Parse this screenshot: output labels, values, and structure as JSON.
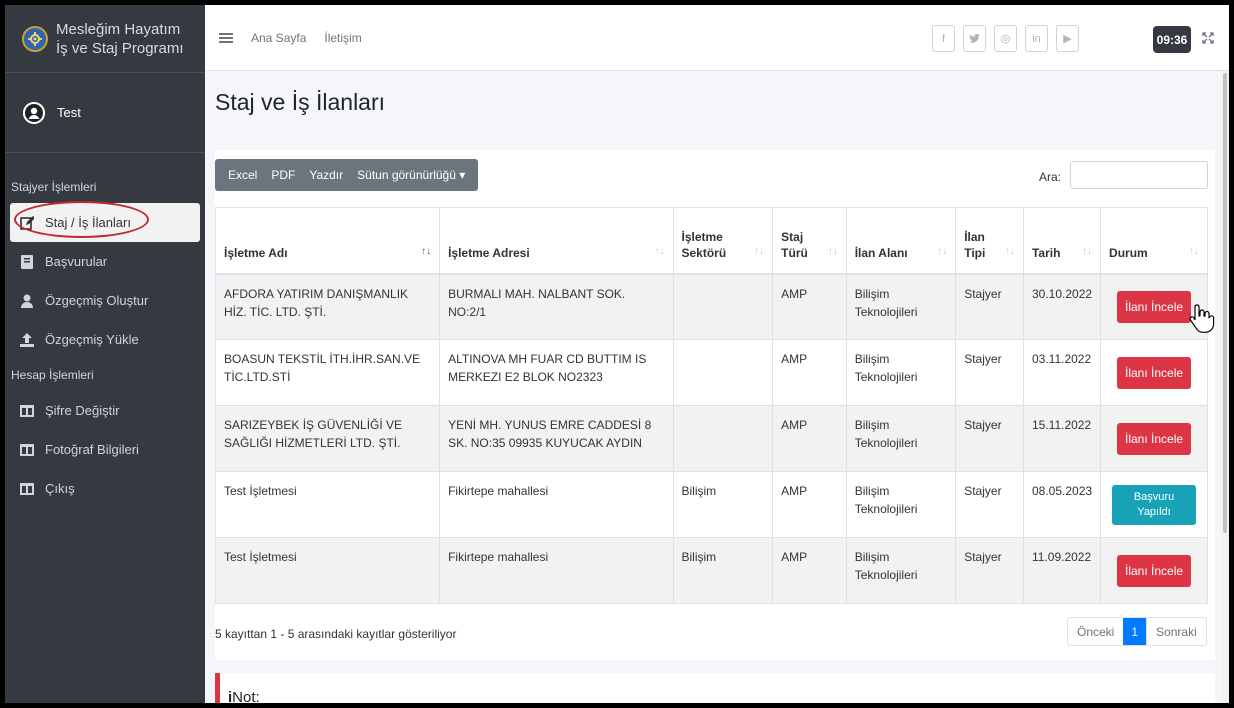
{
  "brand": {
    "line1": "Mesleğim Hayatım",
    "line2": "İş ve Staj Programı"
  },
  "user": {
    "name": "Test"
  },
  "sidebar": {
    "section1": "Stajyer İşlemleri",
    "items1": [
      {
        "label": "Staj / İş İlanları",
        "icon": "edit-icon"
      },
      {
        "label": "Başvurular",
        "icon": "book-icon"
      },
      {
        "label": "Özgeçmiş Oluştur",
        "icon": "user-icon"
      },
      {
        "label": "Özgeçmiş Yükle",
        "icon": "upload-icon"
      }
    ],
    "section2": "Hesap İşlemleri",
    "items2": [
      {
        "label": "Şifre Değiştir",
        "icon": "table-icon"
      },
      {
        "label": "Fotoğraf Bilgileri",
        "icon": "table-icon"
      },
      {
        "label": "Çıkış",
        "icon": "table-icon"
      }
    ]
  },
  "topbar": {
    "home": "Ana Sayfa",
    "contact": "İletişim",
    "clock": "09:36",
    "social": [
      "f",
      "t",
      "◎",
      "in",
      "▶"
    ]
  },
  "page": {
    "title": "Staj ve İş İlanları"
  },
  "toolbar": {
    "excel": "Excel",
    "pdf": "PDF",
    "print": "Yazdır",
    "columns": "Sütun görünürlüğü ▾"
  },
  "search": {
    "label": "Ara:",
    "value": ""
  },
  "table": {
    "headers": [
      "İşletme Adı",
      "İşletme Adresi",
      "İşletme Sektörü",
      "Staj Türü",
      "İlan Alanı",
      "İlan Tipi",
      "Tarih",
      "Durum"
    ],
    "rows": [
      {
        "name": "AFDORA YATIRIM DANIŞMANLIK HİZ. TİC. LTD. ŞTİ.",
        "address": "BURMALI MAH. NALBANT SOK. NO:2/1",
        "sector": "",
        "type": "AMP",
        "area": "Bilişim Teknolojileri",
        "kind": "Stajyer",
        "date": "30.10.2022",
        "status": "İlanı İncele",
        "status_kind": "review"
      },
      {
        "name": "BOASUN TEKSTİL İTH.İHR.SAN.VE TİC.LTD.STİ",
        "address": "ALTINOVA MH FUAR CD BUTTIM IS MERKEZI E2 BLOK NO2323",
        "sector": "",
        "type": "AMP",
        "area": "Bilişim Teknolojileri",
        "kind": "Stajyer",
        "date": "03.11.2022",
        "status": "İlanı İncele",
        "status_kind": "review"
      },
      {
        "name": "SARIZEYBEK İŞ GÜVENLİĞİ VE SAĞLIĞI HİZMETLERİ LTD. ŞTİ.",
        "address": "YENİ MH. YUNUS EMRE CADDESİ 8 SK. NO:35 09935 KUYUCAK AYDIN",
        "sector": "",
        "type": "AMP",
        "area": "Bilişim Teknolojileri",
        "kind": "Stajyer",
        "date": "15.11.2022",
        "status": "İlanı İncele",
        "status_kind": "review"
      },
      {
        "name": "Test İşletmesi",
        "address": "Fikirtepe mahallesi",
        "sector": "Bilişim",
        "type": "AMP",
        "area": "Bilişim Teknolojileri",
        "kind": "Stajyer",
        "date": "08.05.2023",
        "status": "Başvuru Yapıldı",
        "status_kind": "applied"
      },
      {
        "name": "Test İşletmesi",
        "address": "Fikirtepe mahallesi",
        "sector": "Bilişim",
        "type": "AMP",
        "area": "Bilişim Teknolojileri",
        "kind": "Stajyer",
        "date": "11.09.2022",
        "status": "İlanı İncele",
        "status_kind": "review"
      }
    ]
  },
  "footer": {
    "info": "5 kayıttan 1 - 5 arasındaki kayıtlar gösteriliyor",
    "prev": "Önceki",
    "page": "1",
    "next": "Sonraki"
  },
  "note": {
    "label": "Not:"
  },
  "colors": {
    "sidebar": "#343a40",
    "danger": "#dc3545",
    "info": "#17a2b8",
    "primary": "#007bff"
  }
}
